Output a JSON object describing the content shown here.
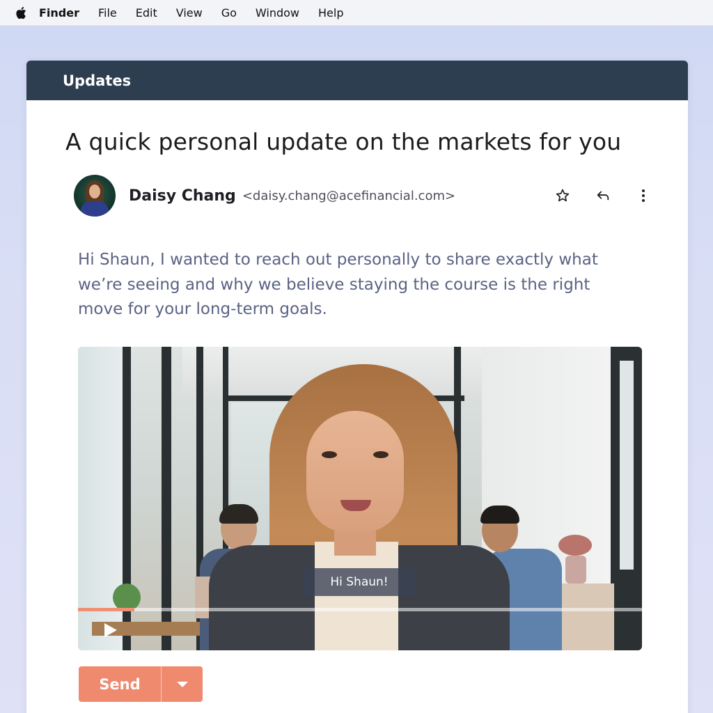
{
  "menubar": {
    "apple_icon": "apple-logo-icon",
    "app_name": "Finder",
    "items": [
      "File",
      "Edit",
      "View",
      "Go",
      "Window",
      "Help"
    ]
  },
  "window": {
    "header_title": "Updates"
  },
  "email": {
    "subject": "A quick personal update on the markets for you",
    "sender_name": "Daisy Chang",
    "sender_email": "<daisy.chang@acefinancial.com>",
    "body": "Hi Shaun, I wanted to reach out personally to share exactly what we’re seeing and why we believe staying the course is the right move for your long-term goals.",
    "actions": [
      "star-icon",
      "reply-icon",
      "more-vertical-icon"
    ]
  },
  "video": {
    "caption": "Hi Shaun!",
    "progress": 0.1,
    "play_icon": "play-icon"
  },
  "send": {
    "label": "Send",
    "dropdown_icon": "caret-down-icon"
  },
  "colors": {
    "header_bg": "#2e3e51",
    "accent": "#ef8a6f",
    "body_text": "#5b6283",
    "desktop_bg": "#d9def5"
  }
}
